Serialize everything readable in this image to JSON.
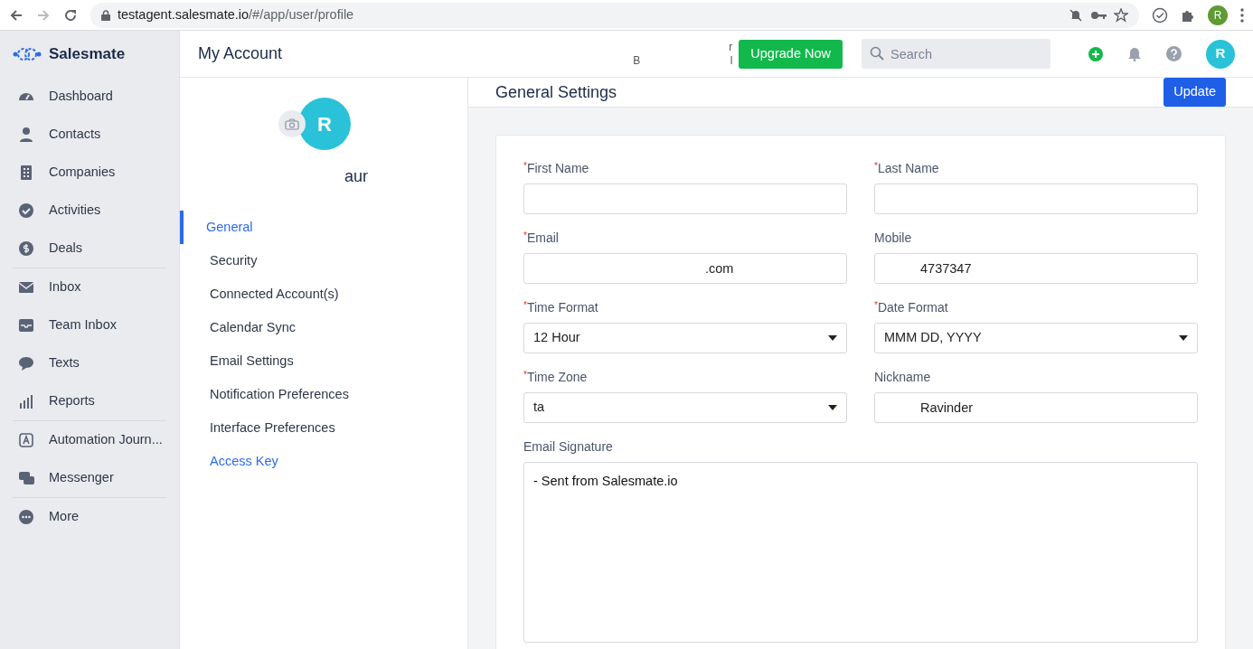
{
  "browser": {
    "url_host": "testagent.salesmate.io",
    "url_path": "/#/app/user/profile",
    "profile_initial": "R"
  },
  "sidebar": {
    "brand": "Salesmate",
    "groups": [
      {
        "items": [
          {
            "label": "Dashboard"
          },
          {
            "label": "Contacts"
          },
          {
            "label": "Companies"
          },
          {
            "label": "Activities"
          },
          {
            "label": "Deals"
          }
        ]
      },
      {
        "items": [
          {
            "label": "Inbox"
          },
          {
            "label": "Team Inbox"
          },
          {
            "label": "Texts"
          },
          {
            "label": "Reports"
          }
        ]
      },
      {
        "items": [
          {
            "label": "Automation Journ..."
          },
          {
            "label": "Messenger"
          }
        ]
      },
      {
        "items": [
          {
            "label": "More"
          }
        ]
      }
    ]
  },
  "header": {
    "title": "My Account",
    "trial_fragments": [
      "r",
      "B",
      "l"
    ],
    "upgrade_button": "Upgrade Now",
    "search": {
      "placeholder": "Search"
    },
    "avatar_initial": "R"
  },
  "profile": {
    "avatar_initial": "R",
    "name": "aur",
    "menu": [
      {
        "label": "General",
        "selected": true,
        "kind": "menu"
      },
      {
        "label": "Security",
        "selected": false,
        "kind": "menu"
      },
      {
        "label": "Connected Account(s)",
        "selected": false,
        "kind": "menu"
      },
      {
        "label": "Calendar Sync",
        "selected": false,
        "kind": "menu"
      },
      {
        "label": "Email Settings",
        "selected": false,
        "kind": "menu"
      },
      {
        "label": "Notification Preferences",
        "selected": false,
        "kind": "menu"
      },
      {
        "label": "Interface Preferences",
        "selected": false,
        "kind": "menu"
      },
      {
        "label": "Access Key",
        "selected": false,
        "kind": "link"
      }
    ]
  },
  "settings": {
    "title": "General Settings",
    "update_button": "Update",
    "fields": [
      {
        "required_mark": "*",
        "label": "First Name",
        "kind": "text"
      },
      {
        "required_mark": "*",
        "label": "Last Name",
        "kind": "text"
      },
      {
        "required_mark": "*",
        "label": "Email",
        "kind": "text",
        "value": ".com"
      },
      {
        "label": "Mobile",
        "kind": "text",
        "value": "4737347"
      },
      {
        "required_mark": "*",
        "label": "Time Format",
        "kind": "select",
        "value": "12 Hour"
      },
      {
        "required_mark": "*",
        "label": "Date Format",
        "kind": "select",
        "value": "MMM DD, YYYY"
      },
      {
        "required_mark": "*",
        "label": "Time Zone",
        "kind": "select",
        "value": "ta"
      },
      {
        "label": "Nickname",
        "kind": "text",
        "value": "Ravinder"
      },
      {
        "label": "Email Signature",
        "kind": "textarea",
        "value": "- Sent from Salesmate.io"
      }
    ]
  }
}
